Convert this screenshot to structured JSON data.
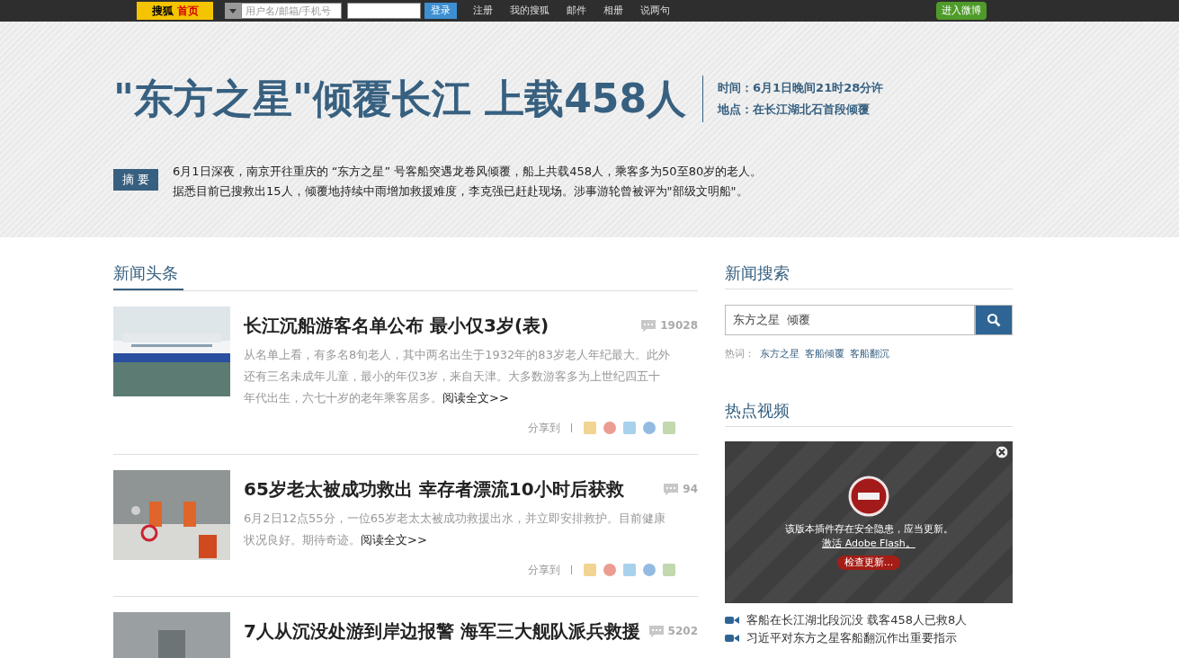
{
  "topbar": {
    "logo": {
      "brand": "搜狐",
      "home": "首页"
    },
    "username_placeholder": "用户名/邮箱/手机号",
    "login": "登录",
    "links": [
      "注册",
      "我的搜狐",
      "邮件",
      "相册",
      "说两句"
    ],
    "weibo": "进入微博"
  },
  "banner": {
    "title": "\"东方之星\"倾覆长江 上载458人",
    "time": "时间：6月1日晚间21时28分许",
    "place": "地点：在长江湖北石首段倾覆",
    "summary_label": "摘 要",
    "summary": [
      "6月1日深夜，南京开往重庆的 “东方之星” 号客船突遇龙卷风倾覆，船上共载458人，乘客多为50至80岁的老人。",
      "据悉目前已搜救出15人，倾覆地持续中雨增加救援难度，李克强已赶赴现场。涉事游轮曾被评为\"部级文明船\"。"
    ]
  },
  "news": {
    "heading": "新闻头条",
    "articles": [
      {
        "title": "长江沉船游客名单公布 最小仅3岁(表)",
        "comments": "19028",
        "summary": "从名单上看，有多名8旬老人，其中两名出生于1932年的83岁老人年纪最大。此外还有三名未成年儿童，最小的年仅3岁，来自天津。大多数游客多为上世纪四五十年代出生，六七十岁的老年乘客居多。",
        "more": "阅读全文>>",
        "share": "分享到"
      },
      {
        "title": "65岁老太被成功救出 幸存者漂流10小时后获救",
        "comments": "94",
        "summary": "6月2日12点55分，一位65岁老太太被成功救援出水，并立即安排救护。目前健康状况良好。期待奇迹。",
        "more": "阅读全文>>",
        "share": "分享到"
      },
      {
        "title": "7人从沉没处游到岸边报警 海军三大舰队派兵救援",
        "comments": "5202"
      }
    ]
  },
  "search": {
    "heading": "新闻搜索",
    "value": "东方之星  倾覆",
    "hot_label": "热词：",
    "hot_words": [
      "东方之星",
      "客船倾覆",
      "客船翻沉"
    ]
  },
  "video": {
    "heading": "热点视频",
    "plugin": {
      "message": "该版本插件存在安全隐患，应当更新。",
      "activate": "激活 Adobe Flash。",
      "check": "检查更新..."
    },
    "items": [
      "客船在长江湖北段沉没 载客458人已救8人",
      "习近平对东方之星客船翻沉作出重要指示"
    ]
  }
}
